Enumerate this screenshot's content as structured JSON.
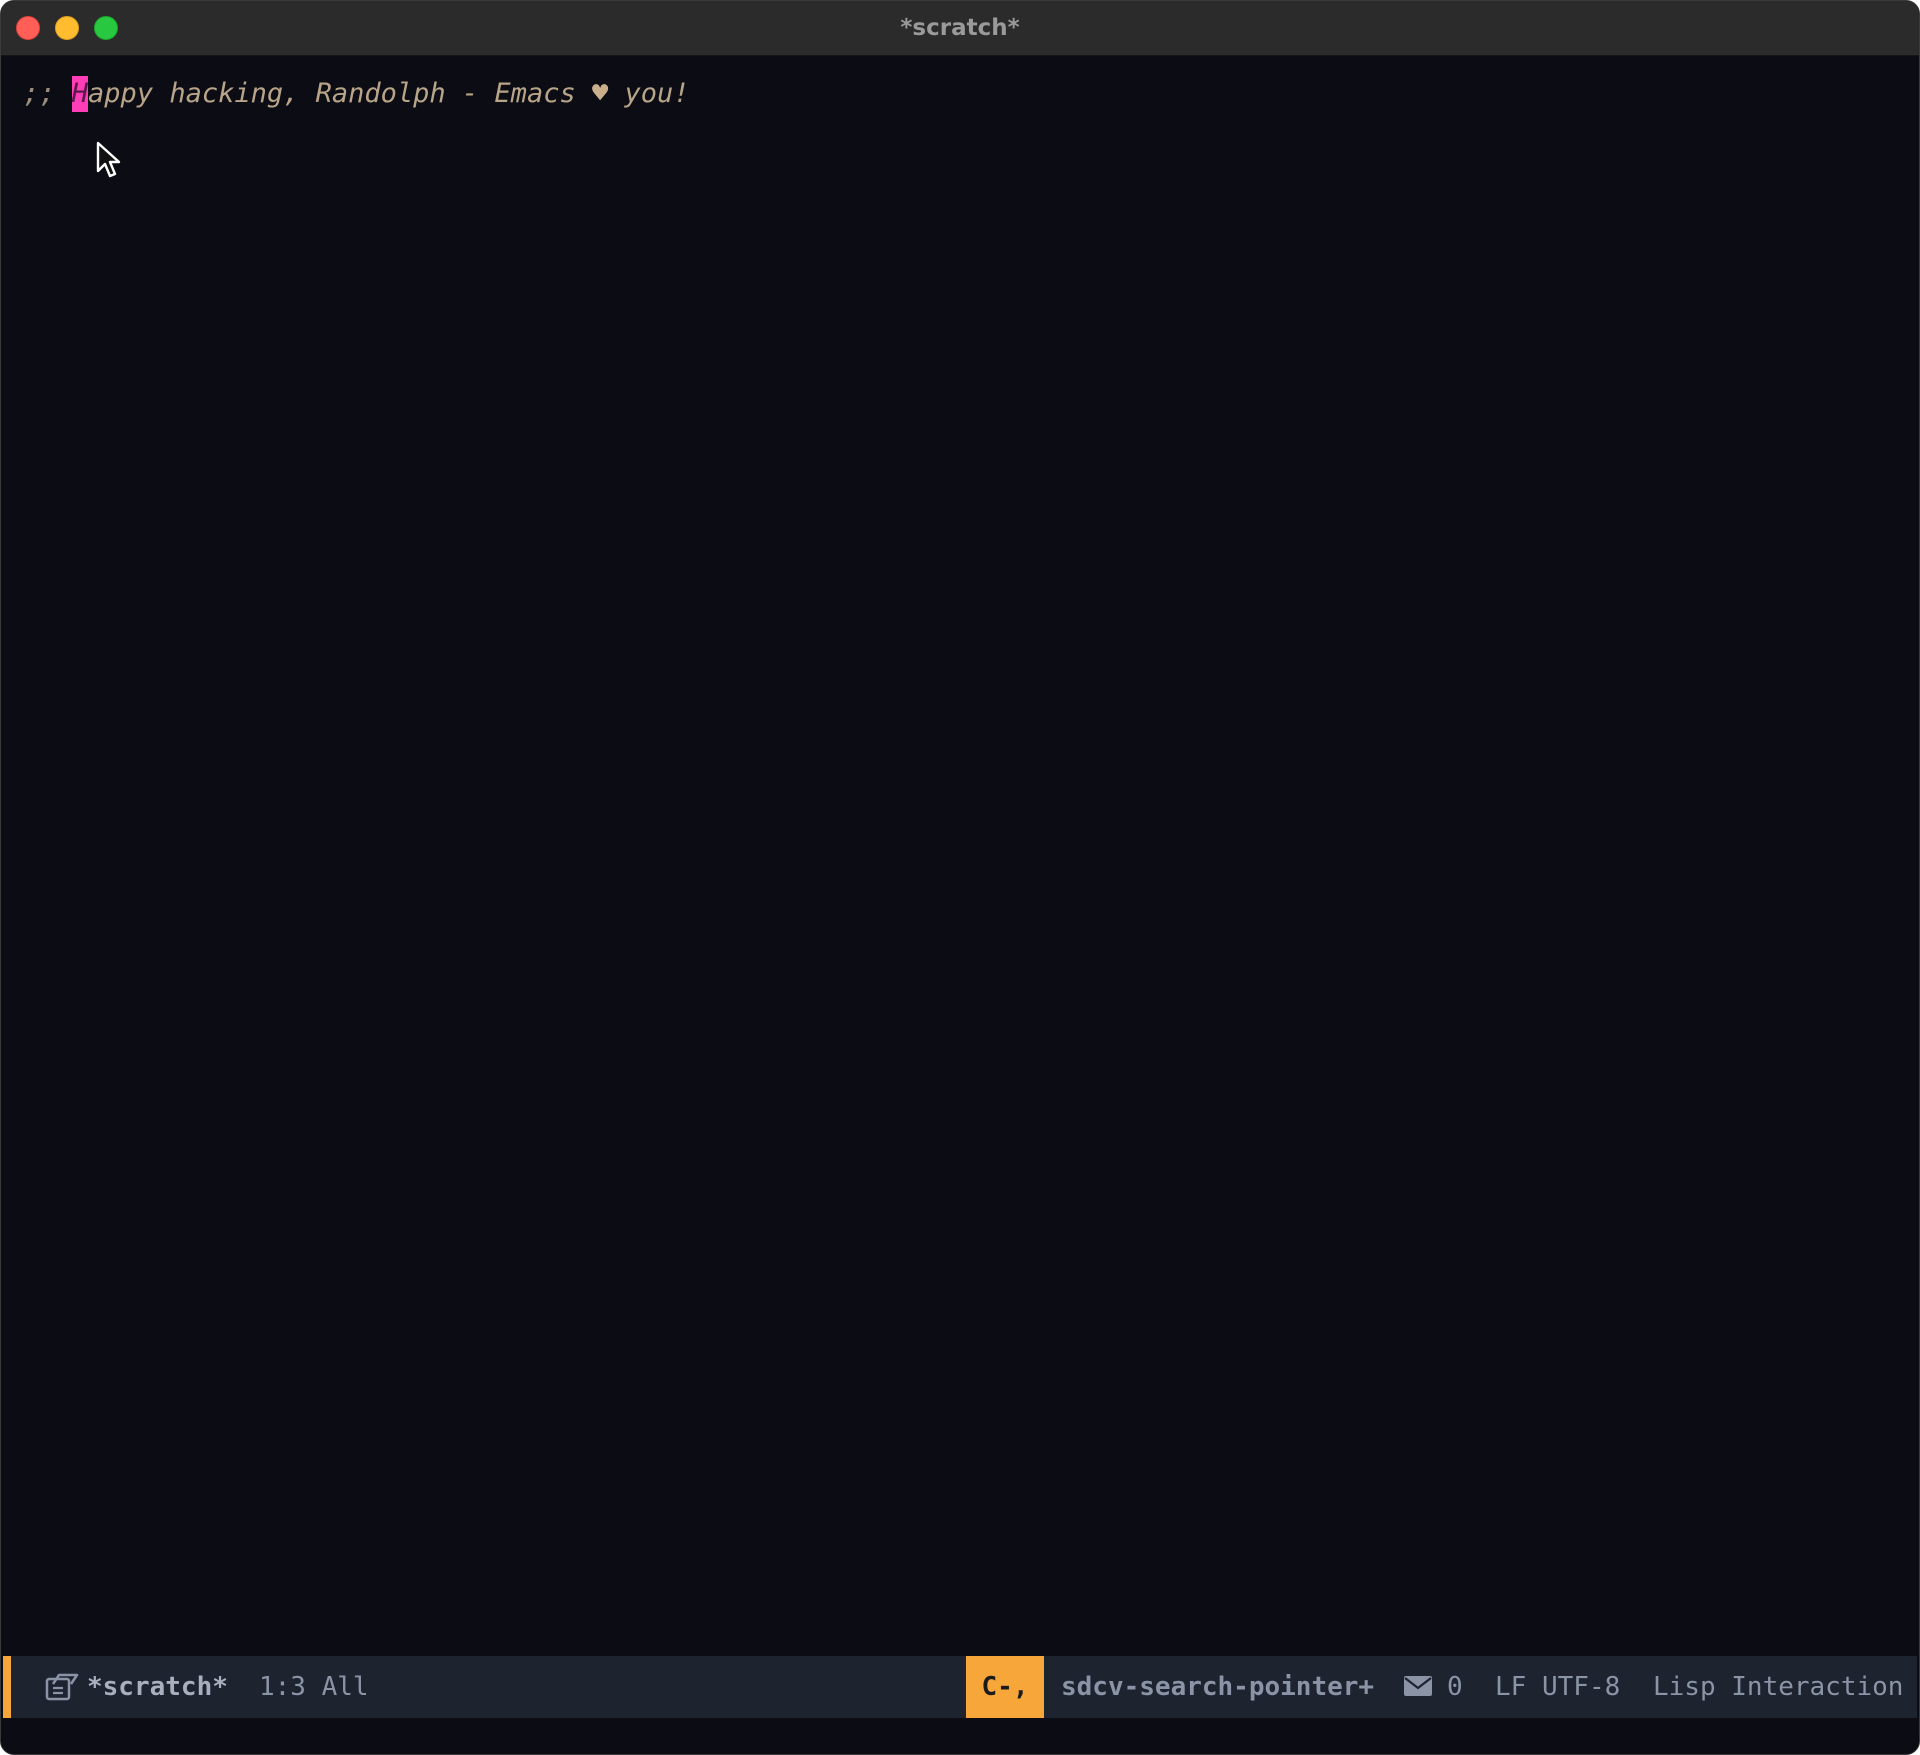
{
  "window": {
    "title": "*scratch*"
  },
  "colors": {
    "close": "#ff5f57",
    "minimize": "#febc2e",
    "maximize": "#28c840",
    "background": "#0c0c14",
    "cursor": "#ff3db6",
    "accent": "#f7a739",
    "modeline_bg": "#1d2430"
  },
  "editor": {
    "line1": {
      "delimiter": ";; ",
      "cursor_char": "H",
      "text_before_heart": "appy hacking, Randolph - Emacs ",
      "heart": "♥",
      "text_after_heart": " you!"
    },
    "pointer_icon": "mouse-pointer-icon"
  },
  "modeline": {
    "buffer_icon": "file-icon",
    "buffer_name": "*scratch*",
    "position": "1:3 All",
    "key": "C-,",
    "command": "sdcv-search-pointer+",
    "mail_icon": "mail-icon",
    "mail_count": "0",
    "eol": "LF",
    "encoding": "UTF-8",
    "major_mode": "Lisp Interaction"
  }
}
